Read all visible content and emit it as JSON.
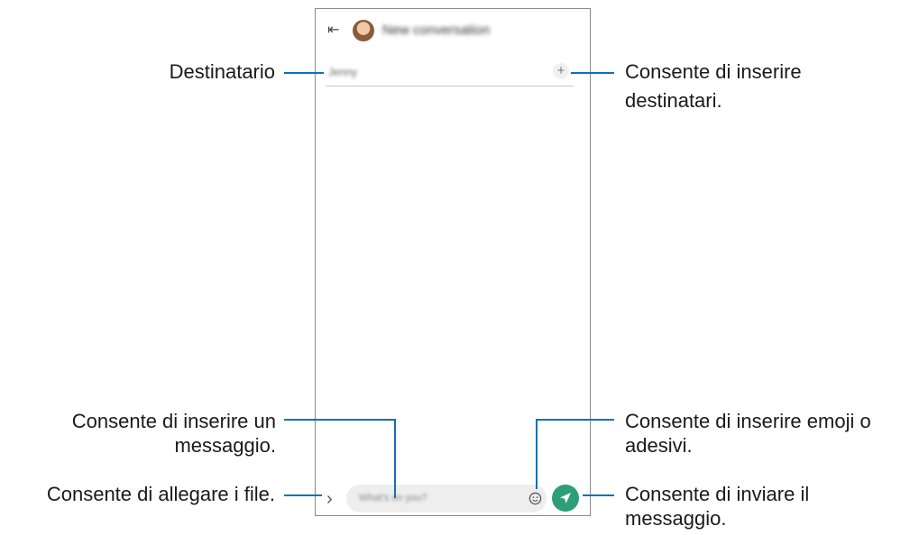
{
  "phone": {
    "back_glyph": "⇤",
    "title": "New conversation",
    "recipient_placeholder": "Jenny",
    "add_glyph": "+",
    "attach_glyph": "›",
    "message_placeholder": "What's on you?",
    "send_color": "#2e9e78"
  },
  "callouts": {
    "recipient": "Destinatario",
    "add_recipients_line1": "Consente di inserire",
    "add_recipients_line2": "destinatari.",
    "enter_message_line1": "Consente di inserire un",
    "enter_message_line2": "messaggio.",
    "attach_files": "Consente di allegare i file.",
    "emoji_line1": "Consente di inserire emoji o",
    "emoji_line2": "adesivi.",
    "send_line1": "Consente di inviare il",
    "send_line2": "messaggio."
  },
  "colors": {
    "leader_line": "#0e71b3",
    "send_button": "#2e9e78"
  }
}
